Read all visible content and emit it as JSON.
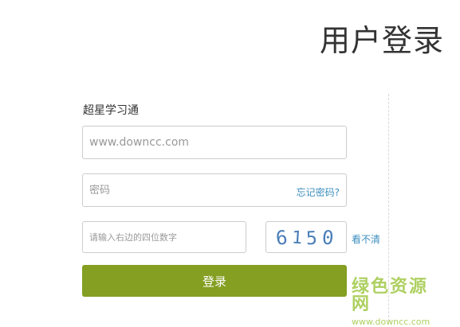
{
  "header": {
    "title": "用户登录"
  },
  "form": {
    "app_name": "超星学习通",
    "username": {
      "value": "",
      "placeholder": "www.downcc.com"
    },
    "password": {
      "value": "",
      "placeholder": "密码",
      "forgot_label": "忘记密码?"
    },
    "captcha": {
      "value": "",
      "placeholder": "请输入右边的四位数字",
      "image_text": "6150",
      "refresh_label": "看不清"
    },
    "submit_label": "登录"
  },
  "watermark": {
    "text": "绿色资源网",
    "url": "www.downcc.com"
  },
  "colors": {
    "accent": "#849f22",
    "link": "#3d8fbf",
    "border": "#cccccc",
    "watermark": "#a6cc52"
  }
}
